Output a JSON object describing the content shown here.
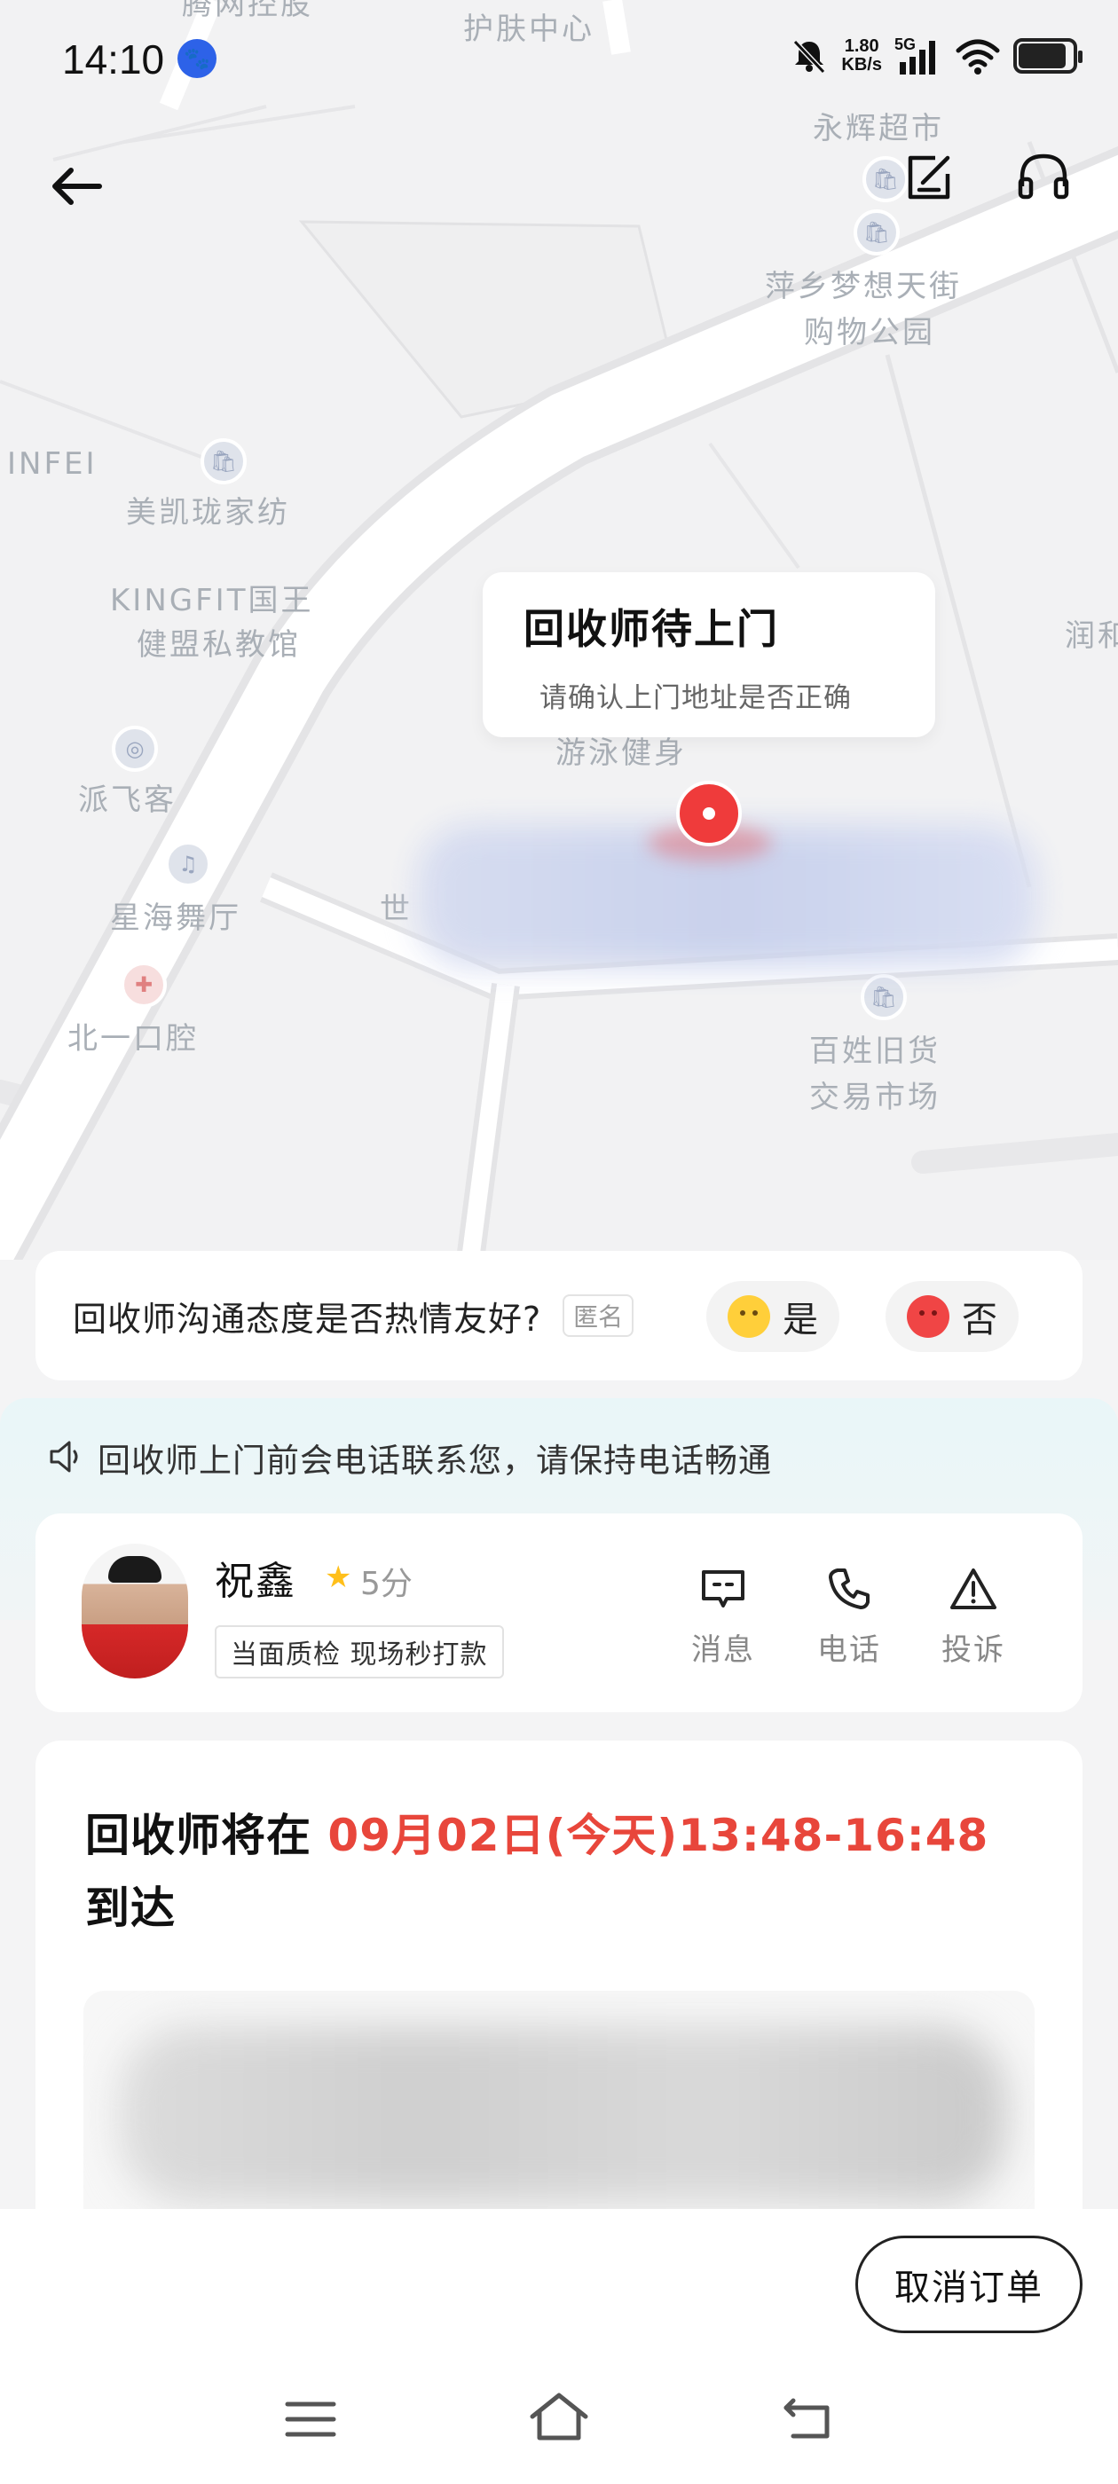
{
  "status_bar": {
    "time": "14:10",
    "net_speed_value": "1.80",
    "net_speed_unit": "KB/s",
    "net_type": "5G",
    "battery_level": 0.85
  },
  "map": {
    "pois": [
      {
        "name": "腾网控股"
      },
      {
        "name": "护肤中心"
      },
      {
        "name": "永辉超市"
      },
      {
        "name": "萍乡梦想天街"
      },
      {
        "name": "购物公园"
      },
      {
        "name": "INFEI"
      },
      {
        "name": "美凯珑家纺"
      },
      {
        "name": "KINGFIT国王"
      },
      {
        "name": "健盟私教馆"
      },
      {
        "name": "润和"
      },
      {
        "name": "游泳健身"
      },
      {
        "name": "派飞客"
      },
      {
        "name": "星海舞厅"
      },
      {
        "name": "世"
      },
      {
        "name": "北一口腔"
      },
      {
        "name": "百姓旧货"
      },
      {
        "name": "交易市场"
      }
    ],
    "bubble_title": "回收师待上门",
    "bubble_subtitle": "请确认上门地址是否正确"
  },
  "rating": {
    "question": "回收师沟通态度是否热情友好?",
    "anonymous_tag": "匿名",
    "yes_label": "是",
    "no_label": "否"
  },
  "notice": {
    "text": "回收师上门前会电话联系您，请保持电话畅通"
  },
  "staff": {
    "name": "祝鑫",
    "score": "5分",
    "tag": "当面质检 现场秒打款",
    "actions": {
      "message": "消息",
      "phone": "电话",
      "complaint": "投诉"
    }
  },
  "arrival": {
    "prefix": "回收师将在",
    "time": "09月02日(今天)13:48-16:48",
    "suffix": "到达"
  },
  "bottom": {
    "cancel_label": "取消订单"
  },
  "colors": {
    "accent_red": "#e8463b",
    "star": "#ffbf1a",
    "pin": "#ef3b3b"
  }
}
